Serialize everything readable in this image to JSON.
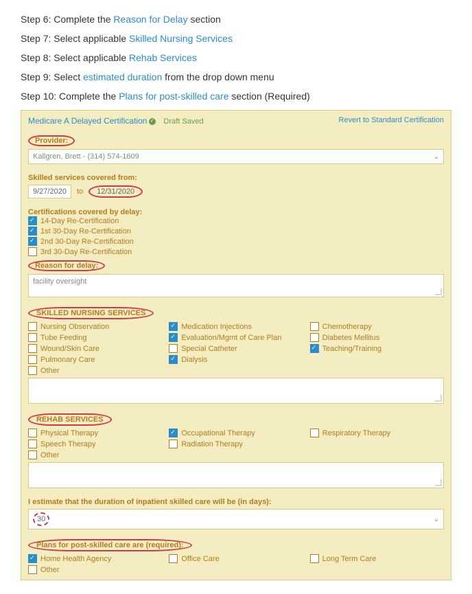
{
  "steps": {
    "s6_pre": "Step 6: Complete the ",
    "s6_link": "Reason for Delay",
    "s6_post": " section",
    "s7_pre": "Step 7: Select applicable ",
    "s7_link": "Skilled Nursing Services",
    "s8_pre": "Step 8: Select applicable ",
    "s8_link": "Rehab Services",
    "s9_pre": "Step 9: Select ",
    "s9_link": "estimated duration",
    "s9_post": " from the drop down menu",
    "s10_pre": "Step 10: Complete the ",
    "s10_link": "Plans for post-skilled care",
    "s10_post": " section (Required)"
  },
  "form": {
    "title": "Medicare A Delayed Certification",
    "draft": "Draft Saved",
    "revert": "Revert to Standard Certification",
    "provider_label": "Provider:",
    "provider_value": "Kallgren, Brett - (314) 574-1609",
    "covered_label": "Skilled services covered from:",
    "date_from": "9/27/2020",
    "to": "to",
    "date_to": "12/31/2020",
    "cert_header": "Certifications covered by delay:",
    "cert_items": {
      "c0": "14-Day Re-Certification",
      "c1": "1st 30-Day Re-Certification",
      "c2": "2nd 30-Day Re-Certification",
      "c3": "3rd 30-Day Re-Certification"
    },
    "reason_label": "Reason for delay:",
    "reason_value": "facility oversight",
    "sns_label": "SKILLED NURSING SERVICES",
    "sns": {
      "a0": "Nursing Observation",
      "a1": "Medication Injections",
      "a2": "Chemotherapy",
      "b0": "Tube Feeding",
      "b1": "Evaluation/Mgmt of Care Plan",
      "b2": "Diabetes Mellitus",
      "c0": "Wound/Skin Care",
      "c1": "Special Catheter",
      "c2": "Teaching/Training",
      "d0": "Pulmonary Care",
      "d1": "Dialysis",
      "e0": "Other"
    },
    "rehab_label": "REHAB SERVICES",
    "rehab": {
      "a0": "Physical Therapy",
      "a1": "Occupational Therapy",
      "a2": "Respiratory Therapy",
      "b0": "Speech Therapy",
      "b1": "Radiation Therapy",
      "c0": "Other"
    },
    "estimate_label": "I estimate that the duration of inpatient skilled care will be (in days):",
    "estimate_value": "30",
    "plans_label": "Plans for post-skilled care are (required):",
    "plans": {
      "a0": "Home Health Agency",
      "a1": "Office Care",
      "a2": "Long Term Care",
      "b0": "Other"
    }
  }
}
